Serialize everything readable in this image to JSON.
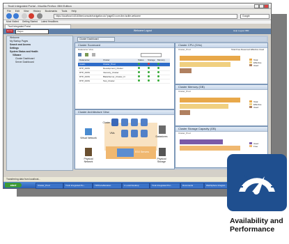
{
  "browser": {
    "title": "Tivoli Integrated Portal - Mozilla Firefox: IBM Edition",
    "menu": [
      "File",
      "Edit",
      "View",
      "History",
      "Bookmarks",
      "Tools",
      "Help"
    ],
    "url": "https://localhost:16316/ibm/console/navigation.do?pageID=com.ibm.isclite.welcome",
    "search_placeholder": "Google",
    "bookmarks": [
      "Most Visited",
      "Getting Started",
      "Latest Headlines"
    ],
    "tab": "Tivoli Integrated Portal"
  },
  "app": {
    "home": "Home",
    "search_value": "Pages",
    "nav_label": "Welcome  Logout",
    "header_right": "Help  Logout  IBM"
  },
  "sidebar": {
    "items": [
      "Welcome",
      "My Startup Pages",
      "Search and Access",
      "Settings",
      "System Status and Health",
      "VMware",
      "Cluster Dashboard",
      "Server Dashboard"
    ]
  },
  "main": {
    "tab": "Cluster Dashboard",
    "scorecard": {
      "title": "Cluster Scorecard",
      "subtitle": "Datacenter View",
      "columns": [
        "Datacenter",
        "Cluster",
        "Status",
        "Storage",
        "Memory"
      ],
      "rows": [
        {
          "dc": "Austin",
          "cluster": "Cluster_Prod"
        },
        {
          "dc": "RTP_DATA",
          "cluster": "Development_Cluster"
        },
        {
          "dc": "RTP_DATA",
          "cluster": "Intervoly_Cluster"
        },
        {
          "dc": "RTP_DATA",
          "cluster": "BladeServer_Cluster_N"
        },
        {
          "dc": "RTP_DATA",
          "cluster": "Test_Cluster"
        }
      ]
    },
    "architecture": {
      "title": "Cluster Architecture View",
      "labels": [
        "Virtual Network",
        "Cluster",
        "VMs",
        "Datastores",
        "Physical Network",
        "ESX Servers",
        "Physical Storage"
      ]
    },
    "cpu": {
      "title": "Cluster CPU (GHz)",
      "subtitle": "Cluster_Prod",
      "header_link": "Total  Free  Reserved  Effective  Used"
    },
    "memory": {
      "title": "Cluster Memory (GB)",
      "subtitle": "Cluster_Prod"
    },
    "storage": {
      "title": "Cluster Storage Capacity (GB)",
      "subtitle": "Cluster_Prod"
    },
    "legend": [
      "Total",
      "Effective",
      "Used"
    ],
    "legend_storage": [
      "Used",
      "Free"
    ]
  },
  "status": "Transferring data from localhost...",
  "taskbar": {
    "start": "start",
    "tasks": [
      "Cluster_Prod",
      "Tivoli Integrated Po...",
      "TIPPortalSolution",
      "1 Local Desktop",
      "Tivoli Integrated Por...",
      "Documents",
      "WebSphere Integrat..."
    ]
  },
  "badge": {
    "caption_line1": "Availability and",
    "caption_line2": "Performance",
    "icon": "speedometer-gauge-icon",
    "color": "#1f4f8f"
  },
  "chart_data": [
    {
      "type": "bar",
      "title": "Cluster CPU (GHz)",
      "categories": [
        "Total",
        "Effective",
        "Used"
      ],
      "values": [
        60,
        50,
        12
      ]
    },
    {
      "type": "bar",
      "title": "Cluster Memory (GB)",
      "categories": [
        "Total",
        "Effective",
        "Used"
      ],
      "values": [
        60,
        48,
        10
      ]
    },
    {
      "type": "bar",
      "title": "Cluster Storage Capacity (GB)",
      "categories": [
        "Used",
        "Free"
      ],
      "values": [
        64,
        90
      ]
    }
  ]
}
